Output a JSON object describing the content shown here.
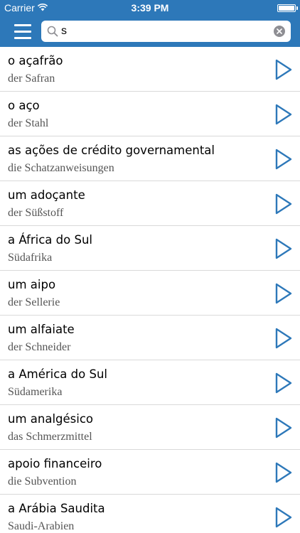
{
  "status_bar": {
    "carrier": "Carrier",
    "time": "3:39 PM"
  },
  "search": {
    "value": "s",
    "placeholder": ""
  },
  "entries": [
    {
      "term": "o açafrão",
      "translation": "der Safran"
    },
    {
      "term": "o aço",
      "translation": "der Stahl"
    },
    {
      "term": "as ações de crédito governamental",
      "translation": "die Schatzanweisungen"
    },
    {
      "term": "um adoçante",
      "translation": "der Süßstoff"
    },
    {
      "term": "a África do Sul",
      "translation": "Südafrika"
    },
    {
      "term": "um aipo",
      "translation": "der Sellerie"
    },
    {
      "term": "um alfaiate",
      "translation": "der Schneider"
    },
    {
      "term": "a América do Sul",
      "translation": "Südamerika"
    },
    {
      "term": "um analgésico",
      "translation": "das Schmerzmittel"
    },
    {
      "term": "apoio financeiro",
      "translation": "die Subvention"
    },
    {
      "term": "a Arábia Saudita",
      "translation": "Saudi-Arabien"
    }
  ],
  "colors": {
    "nav_background": "#2d78b9",
    "play_icon": "#2d78b9",
    "divider": "#d9d9d9"
  },
  "icons": {
    "menu": "menu-icon",
    "search": "search-icon",
    "clear": "clear-icon",
    "play": "play-icon",
    "wifi": "wifi-icon",
    "battery": "battery-icon"
  }
}
